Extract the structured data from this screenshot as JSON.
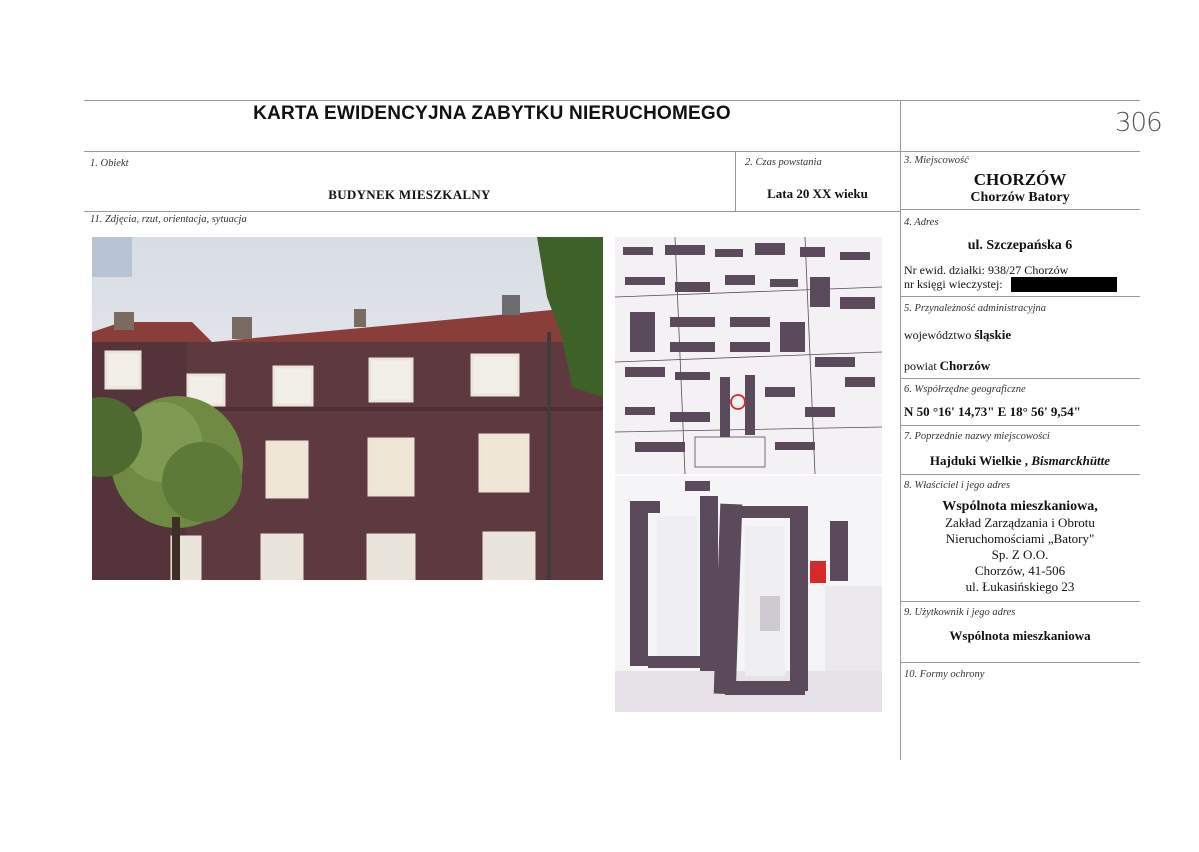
{
  "page_number": "306",
  "title": "KARTA EWIDENCYJNA ZABYTKU NIERUCHOMEGO",
  "obiekt": {
    "label": "1. Obiekt",
    "value": "BUDYNEK MIESZKALNY"
  },
  "czas": {
    "label": "2. Czas powstania",
    "value": "Lata 20 XX wieku"
  },
  "miejscowosc": {
    "label": "3. Miejscowość",
    "value": "CHORZÓW",
    "sub": "Chorzów Batory"
  },
  "adres": {
    "label": "4. Adres",
    "street": "ul. Szczepańska 6",
    "dzialka": "Nr ewid. działki: 938/27 Chorzów",
    "ksiega": "nr księgi wieczystej:"
  },
  "przynaleznosc": {
    "label": "5. Przynależność administracyjna",
    "woj_prefix": "województwo",
    "woj": "śląskie",
    "powiat_prefix": "powiat",
    "powiat": "Chorzów"
  },
  "wspolrzedne": {
    "label": "6. Współrzędne geograficzne",
    "value": "N 50 °16' 14,73\" E 18° 56' 9,54\""
  },
  "poprzednie": {
    "label": "7. Poprzednie nazwy miejscowości",
    "value1": "Hajduki Wielkie ,",
    "value2": "Bismarckhütte"
  },
  "wlasciciel": {
    "label": "8. Właściciel i jego adres",
    "lines": [
      "Wspólnota mieszkaniowa,",
      "Zakład Zarządzania i Obrotu",
      "Nieruchomościami „Batory\"",
      "Sp. Z O.O.",
      "Chorzów, 41-506",
      "ul. Łukasińskiego 23"
    ]
  },
  "uzytkownik": {
    "label": "9. Użytkownik i jego adres",
    "value": "Wspólnota mieszkaniowa"
  },
  "formy": {
    "label": "10. Formy ochrony"
  },
  "zdjecia": {
    "label": "11. Zdjęcia, rzut, orientacja, sytuacja"
  },
  "colors": {
    "facade": "#5e3a40",
    "roof": "#8a3e3a",
    "map_block": "#5a4a5c",
    "marker": "#d42a2a"
  }
}
